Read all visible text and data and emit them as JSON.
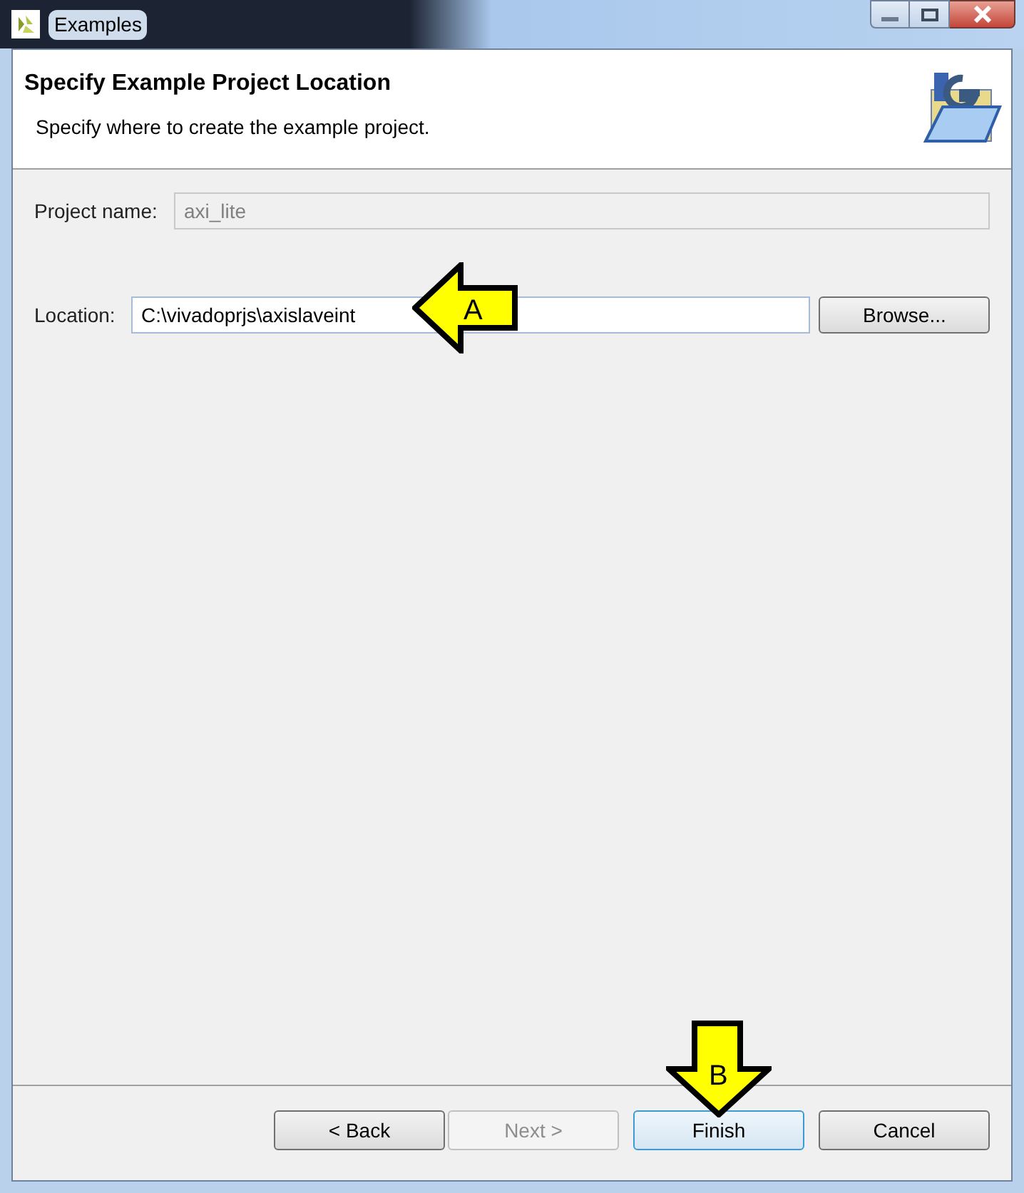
{
  "window": {
    "title": "Examples"
  },
  "header": {
    "title": "Specify Example Project Location",
    "description": "Specify where to create the example project."
  },
  "fields": [
    {
      "label": "Project name:",
      "value": "axi_lite",
      "disabled": true
    },
    {
      "label": "Location:",
      "value": "C:\\vivadoprjs\\axislaveint",
      "disabled": false
    }
  ],
  "browse_button": {
    "label": "Browse..."
  },
  "callouts": [
    {
      "label": "A",
      "kind": "left"
    },
    {
      "label": "B",
      "kind": "down"
    }
  ],
  "buttons": [
    {
      "label": "< Back",
      "disabled": false,
      "focused": false
    },
    {
      "label": "Next >",
      "disabled": true,
      "focused": false
    },
    {
      "label": "Finish",
      "disabled": false,
      "focused": true
    },
    {
      "label": "Cancel",
      "disabled": false,
      "focused": false
    }
  ]
}
